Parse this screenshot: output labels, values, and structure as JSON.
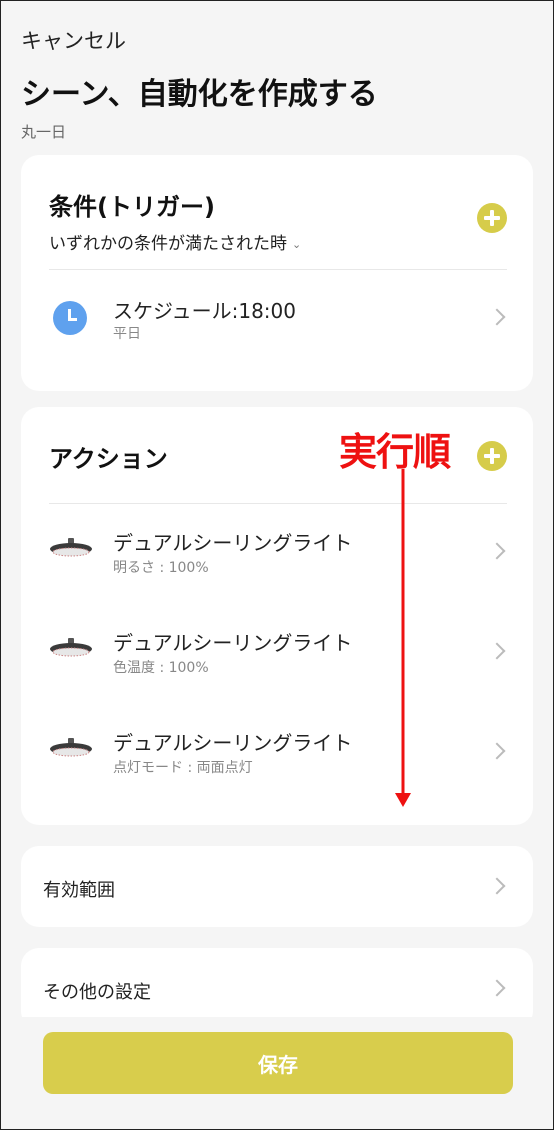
{
  "header": {
    "cancel_label": "キャンセル",
    "title": "シーン、自動化を作成する",
    "name": "丸一日"
  },
  "conditions": {
    "title": "条件(トリガー)",
    "trigger_mode": "いずれかの条件が満たされた時",
    "items": [
      {
        "icon": "clock-icon",
        "title": "スケジュール:18:00",
        "subtitle": "平日"
      }
    ]
  },
  "actions": {
    "title": "アクション",
    "items": [
      {
        "icon": "ceiling-light-icon",
        "title": "デュアルシーリングライト",
        "subtitle": "明るさ : 100%"
      },
      {
        "icon": "ceiling-light-icon",
        "title": "デュアルシーリングライト",
        "subtitle": "色温度 : 100%"
      },
      {
        "icon": "ceiling-light-icon",
        "title": "デュアルシーリングライト",
        "subtitle": "点灯モード : 両面点灯"
      }
    ]
  },
  "annotation": {
    "label": "実行順",
    "color": "#ee1111"
  },
  "settings": {
    "effective_range_label": "有効範囲",
    "other_settings_label": "その他の設定"
  },
  "footer": {
    "save_label": "保存"
  },
  "colors": {
    "accent": "#d8cd4c",
    "clock_icon": "#5fa1ee",
    "background": "#f5f5f5",
    "card": "#ffffff"
  }
}
